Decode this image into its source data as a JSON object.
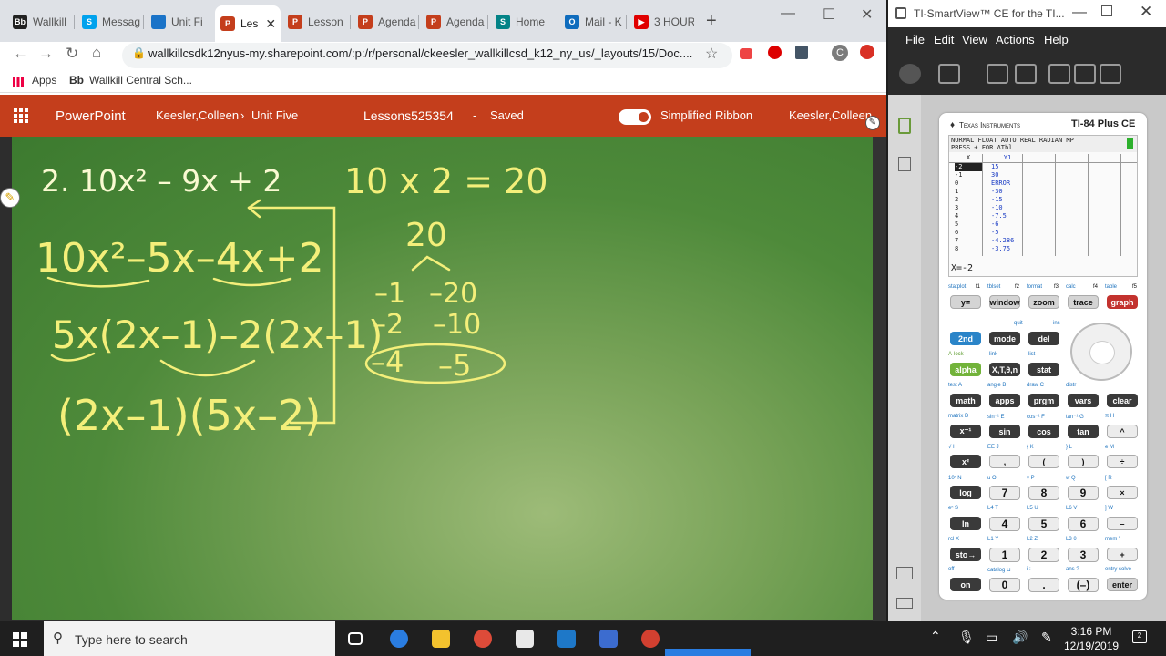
{
  "browser": {
    "tabs": [
      {
        "title": "Wallkill",
        "icon": "blackboard-icon",
        "color": "#222222",
        "glyph": "Bb"
      },
      {
        "title": "Messag",
        "icon": "skype-icon",
        "color": "#00a2ed",
        "glyph": "S"
      },
      {
        "title": "Unit Fi",
        "icon": "onedrive-icon",
        "color": "#1a73c8",
        "glyph": ""
      },
      {
        "title": "Les",
        "icon": "powerpoint-icon",
        "color": "#c43e1c",
        "glyph": "P",
        "active": true
      },
      {
        "title": "Lesson",
        "icon": "powerpoint-icon",
        "color": "#c43e1c",
        "glyph": "P"
      },
      {
        "title": "Agenda",
        "icon": "powerpoint-icon",
        "color": "#c43e1c",
        "glyph": "P"
      },
      {
        "title": "Agenda",
        "icon": "powerpoint-icon",
        "color": "#c43e1c",
        "glyph": "P"
      },
      {
        "title": "Home",
        "icon": "sharepoint-icon",
        "color": "#038387",
        "glyph": "S"
      },
      {
        "title": "Mail - K",
        "icon": "outlook-icon",
        "color": "#0f6cbd",
        "glyph": "O"
      },
      {
        "title": "3 HOUR",
        "icon": "youtube-icon",
        "color": "#e00000",
        "glyph": "▶"
      }
    ],
    "url": "wallkillcsdk12nyus-my.sharepoint.com/:p:/r/personal/ckeesler_wallkillcsd_k12_ny_us/_layouts/15/Doc....",
    "bookmarks": [
      {
        "label": "Apps"
      },
      {
        "label": "Wallkill Central Sch...",
        "icon_text": "Bb"
      }
    ],
    "profile_initial": "C"
  },
  "ppt": {
    "app": "PowerPoint",
    "breadcrumb_user": "Keesler,Colleen",
    "breadcrumb_sep": "›",
    "breadcrumb_folder": "Unit Five",
    "doc_title": "Lessons525354",
    "doc_sep": "-",
    "doc_status": "Saved",
    "ribbon_toggle": "Simplified Ribbon",
    "user": "Keesler,Colleen"
  },
  "slide": {
    "problem": "2. 10x² – 9x + 2",
    "ac_line": "10 x 2 = 20",
    "step1": "10x²–5x–4x+2",
    "step2": "5x(2x–1)–2(2x–1)",
    "step3": "(2x–1)(5x–2)",
    "product": "20",
    "pairs": [
      {
        "a": "–1",
        "b": "–20"
      },
      {
        "a": "–2",
        "b": "–10"
      },
      {
        "a": "–4",
        "b": "–5"
      }
    ]
  },
  "ti": {
    "window_title": "TI-SmartView™ CE for the TI...",
    "menu": [
      "File",
      "Edit",
      "View",
      "Actions",
      "Help"
    ],
    "brand": "Texas Instruments",
    "model": "TI-84 Plus CE",
    "lcd_header_1": "NORMAL FLOAT AUTO REAL RADIAN MP",
    "lcd_header_2": "PRESS + FOR ΔTbl",
    "col_x": "X",
    "col_y": "Y1",
    "table": [
      {
        "x": "-2",
        "y": "15"
      },
      {
        "x": "-1",
        "y": "30"
      },
      {
        "x": "0",
        "y": "ERROR"
      },
      {
        "x": "1",
        "y": "-30"
      },
      {
        "x": "2",
        "y": "-15"
      },
      {
        "x": "3",
        "y": "-10"
      },
      {
        "x": "4",
        "y": "-7.5"
      },
      {
        "x": "5",
        "y": "-6"
      },
      {
        "x": "6",
        "y": "-5"
      },
      {
        "x": "7",
        "y": "-4.286"
      },
      {
        "x": "8",
        "y": "-3.75"
      }
    ],
    "lcd_footer": "X=-2",
    "func_labels": [
      "statplot",
      "f1",
      "tblset",
      "f2",
      "format",
      "f3",
      "calc",
      "f4",
      "table",
      "f5"
    ],
    "func_keys": [
      "y=",
      "window",
      "zoom",
      "trace",
      "graph"
    ],
    "row2_keys": [
      "2nd",
      "mode",
      "del"
    ],
    "row2_labels": [
      "quit",
      "ins"
    ],
    "row3_keys": [
      "alpha",
      "X,T,θ,n",
      "stat"
    ],
    "row3_labels": [
      "A-lock",
      "link",
      "list"
    ],
    "row4_keys": [
      "math",
      "apps",
      "prgm",
      "vars",
      "clear"
    ],
    "row4_labels": [
      "test A",
      "angle B",
      "draw C",
      "distr"
    ],
    "row5_keys": [
      "x⁻¹",
      "sin",
      "cos",
      "tan",
      "^"
    ],
    "row5_labels": [
      "matrix D",
      "sin⁻¹ E",
      "cos⁻¹ F",
      "tan⁻¹ G",
      "π H"
    ],
    "row6_keys": [
      "x²",
      ",",
      "(",
      ")",
      "÷"
    ],
    "row6_labels": [
      "√ I",
      "EE J",
      "{ K",
      "} L",
      "e M"
    ],
    "row7_keys": [
      "log",
      "7",
      "8",
      "9",
      "×"
    ],
    "row7_labels": [
      "10ˣ N",
      "u O",
      "v P",
      "w Q",
      "[ R"
    ],
    "row8_keys": [
      "ln",
      "4",
      "5",
      "6",
      "–"
    ],
    "row8_labels": [
      "eˣ S",
      "L4 T",
      "L5 U",
      "L6 V",
      "] W"
    ],
    "row9_keys": [
      "sto→",
      "1",
      "2",
      "3",
      "+"
    ],
    "row9_labels": [
      "rcl X",
      "L1 Y",
      "L2 Z",
      "L3 θ",
      "mem \""
    ],
    "row10_keys": [
      "on",
      "0",
      ".",
      "(–)",
      "enter"
    ],
    "row10_labels": [
      "off",
      "catalog ⊔",
      "i :",
      "ans ?",
      "entry solve"
    ]
  },
  "taskbar": {
    "search_placeholder": "Type here to search",
    "time": "3:16 PM",
    "date": "12/19/2019"
  }
}
